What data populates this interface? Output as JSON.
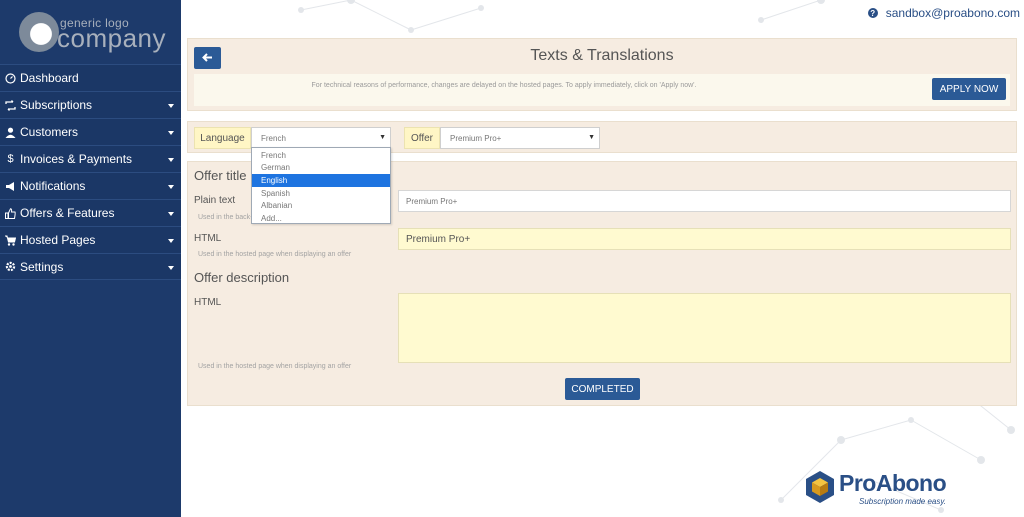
{
  "logo": {
    "small_text": "generic logo",
    "big_text": "company"
  },
  "user": {
    "email": "sandbox@proabono.com"
  },
  "sidebar": {
    "items": [
      {
        "label": "Dashboard",
        "icon": "dashboard-icon",
        "has_submenu": false
      },
      {
        "label": "Subscriptions",
        "icon": "retweet-icon",
        "has_submenu": true
      },
      {
        "label": "Customers",
        "icon": "user-icon",
        "has_submenu": true
      },
      {
        "label": "Invoices & Payments",
        "icon": "dollar-icon",
        "has_submenu": true
      },
      {
        "label": "Notifications",
        "icon": "bullhorn-icon",
        "has_submenu": true
      },
      {
        "label": "Offers & Features",
        "icon": "thumbs-up-icon",
        "has_submenu": true
      },
      {
        "label": "Hosted Pages",
        "icon": "cart-icon",
        "has_submenu": true
      },
      {
        "label": "Settings",
        "icon": "gear-icon",
        "has_submenu": true
      }
    ]
  },
  "header": {
    "title": "Texts & Translations",
    "note": "For technical reasons of performance, changes are delayed on the hosted pages. To apply immediately, click on 'Apply now'.",
    "apply_label": "APPLY NOW"
  },
  "filters": {
    "language_label": "Language",
    "language_value": "French",
    "language_options": [
      "French",
      "German",
      "English",
      "Spanish",
      "Albanian",
      "Add..."
    ],
    "language_highlighted": "English",
    "offer_label": "Offer",
    "offer_value": "Premium Pro+"
  },
  "offer_title": {
    "heading": "Offer title",
    "plain_label": "Plain text",
    "plain_value": "Premium Pro+",
    "plain_hint": "Used in the back-office, in the invoices, ...",
    "html_label": "HTML",
    "html_value": "Premium Pro+",
    "html_hint": "Used in the hosted page when displaying an offer"
  },
  "offer_description": {
    "heading": "Offer description",
    "html_label": "HTML",
    "html_value": "",
    "html_hint": "Used in the hosted page when displaying an offer"
  },
  "actions": {
    "completed_label": "COMPLETED"
  },
  "brand": {
    "name": "ProAbono",
    "tagline": "Subscription made easy."
  },
  "colors": {
    "sidebar": "#1d3a6b",
    "primary_button": "#2b5a96",
    "panel": "#f6ece1",
    "highlight_input": "#fffad0",
    "selected_option": "#1e74e0"
  }
}
